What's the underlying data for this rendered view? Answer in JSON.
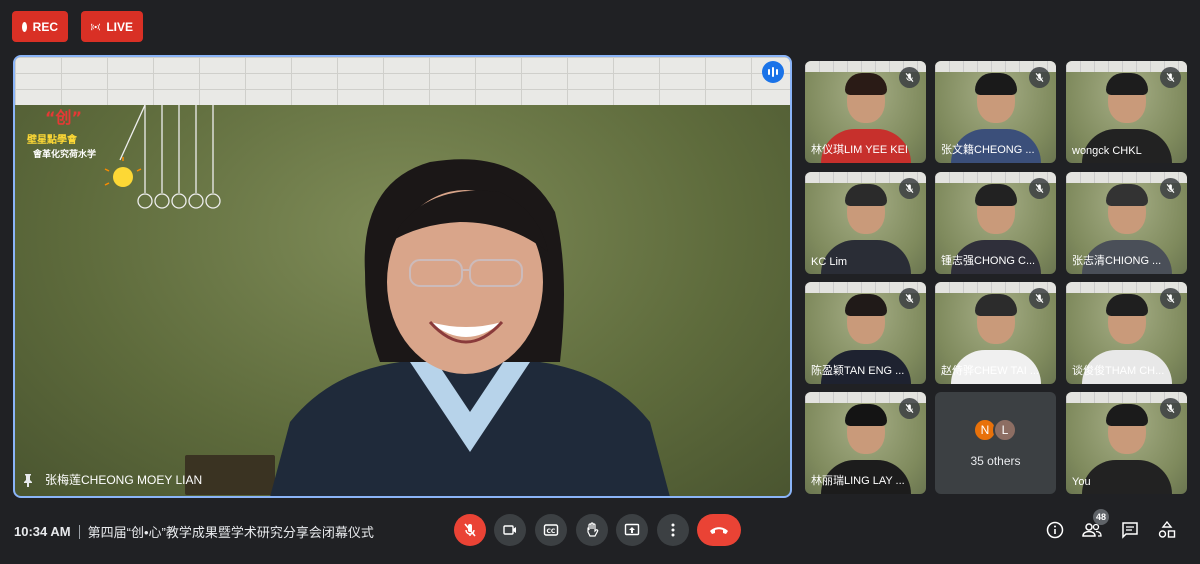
{
  "top": {
    "rec_label": "REC",
    "live_label": "LIVE"
  },
  "main": {
    "speaker_name": "张梅莲CHEONG MOEY LIAN",
    "logo_text": "壁星點學會\n會革化究荷水学"
  },
  "tiles": [
    {
      "name": "林仪琪LIM YEE KEI",
      "muted": true
    },
    {
      "name": "张文籍CHEONG ...",
      "muted": true
    },
    {
      "name": "wongck CHKL",
      "muted": true
    },
    {
      "name": "KC Lim",
      "muted": true
    },
    {
      "name": "锺志强CHONG C...",
      "muted": true
    },
    {
      "name": "张志清CHIONG ...",
      "muted": true
    },
    {
      "name": "陈盈颖TAN ENG ...",
      "muted": true
    },
    {
      "name": "赵侍骅CHEW TAI ...",
      "muted": true
    },
    {
      "name": "谈俊俊THAM CH...",
      "muted": true
    },
    {
      "name": "林丽瑞LING LAY ...",
      "muted": true
    },
    {
      "name": "You",
      "muted": true
    }
  ],
  "others": {
    "label": "35 others",
    "avatars": [
      {
        "letter": "N",
        "color": "#e8710a"
      },
      {
        "letter": "L",
        "color": "#8d6e63"
      }
    ]
  },
  "bottom": {
    "time": "10:34 AM",
    "meeting_title": "第四届“创•心”教学成果暨学术研究分享会闭幕仪式",
    "participants_count": "48"
  },
  "colors": {
    "accent": "#8ab4f8",
    "rec_red": "#d93025",
    "mic_red": "#ea4335",
    "control_bg": "#3c4043",
    "page_bg": "#202124"
  },
  "icons": [
    "rec-dot-icon",
    "live-broadcast-icon",
    "speaking-indicator-icon",
    "pin-icon",
    "mic-off-icon",
    "camera-icon",
    "captions-icon",
    "raise-hand-icon",
    "present-icon",
    "more-options-icon",
    "end-call-icon",
    "info-icon",
    "people-icon",
    "chat-icon",
    "activities-icon"
  ]
}
